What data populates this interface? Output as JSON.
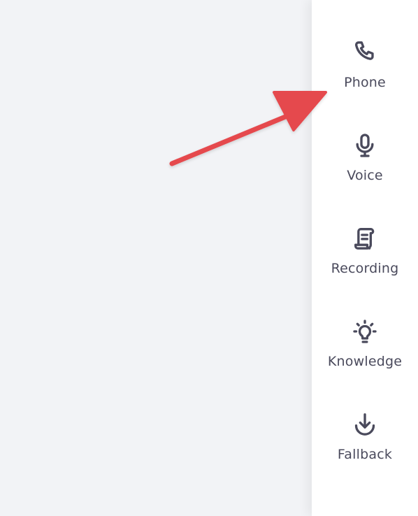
{
  "sidebar": {
    "items": [
      {
        "label": "Phone",
        "icon": "phone-icon"
      },
      {
        "label": "Voice",
        "icon": "microphone-icon"
      },
      {
        "label": "Recording",
        "icon": "scroll-icon"
      },
      {
        "label": "Knowledge",
        "icon": "lightbulb-icon"
      },
      {
        "label": "Fallback",
        "icon": "download-arrow-icon"
      }
    ]
  },
  "colors": {
    "background": "#f2f3f6",
    "sidebar": "#ffffff",
    "text": "#4a4a5c",
    "annotation_arrow": "#e5484d"
  }
}
